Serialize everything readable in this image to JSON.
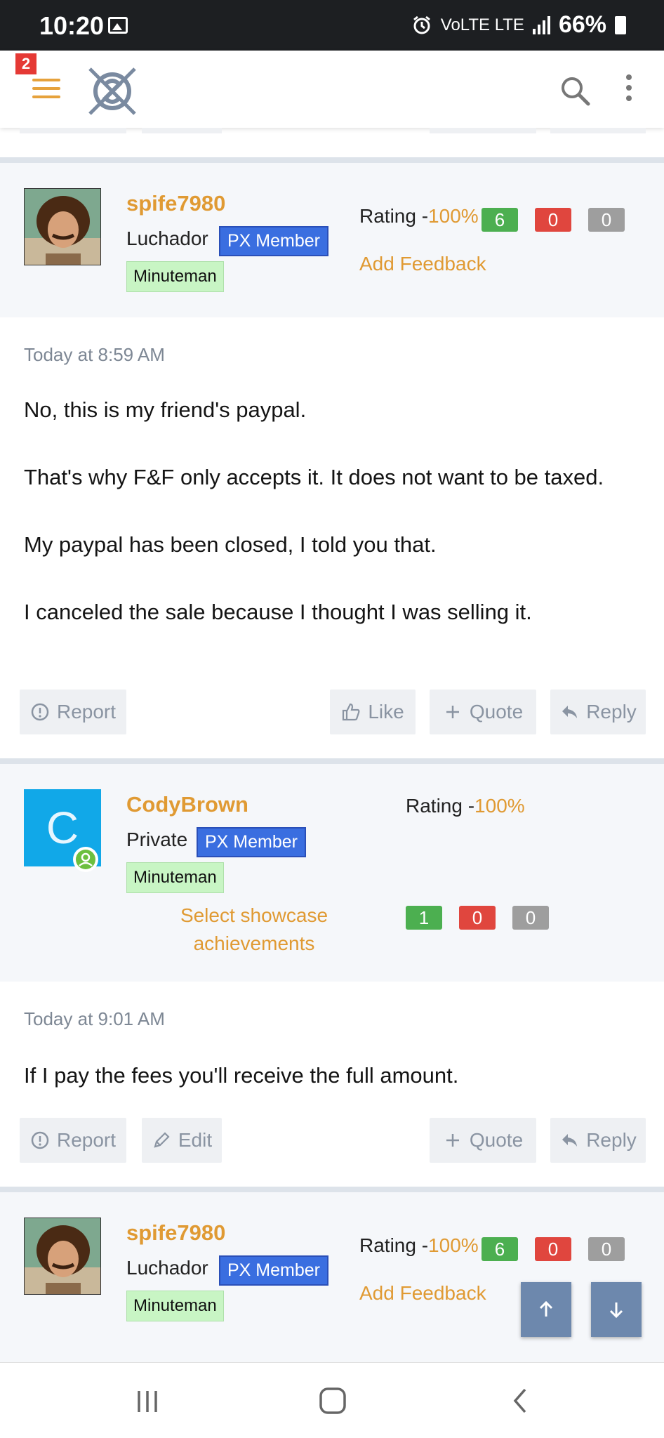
{
  "status": {
    "time": "10:20",
    "lte": "VoLTE LTE",
    "battery": "66%"
  },
  "appbar": {
    "notification_count": "2"
  },
  "posts": [
    {
      "username": "spife7980",
      "rank": "Luchador",
      "px_badge": "PX Member",
      "title_badge": "Minuteman",
      "rating_label": "Rating -",
      "rating_pct": "100%",
      "fb_pos": "6",
      "fb_neg": "0",
      "fb_neu": "0",
      "add_feedback": "Add Feedback",
      "date": "Today at 8:59 AM",
      "message": [
        "No, this is my friend's paypal.",
        "That's why F&F only accepts it. It does not want to be taxed.",
        "My paypal has been closed, I told you that.",
        "I canceled the sale because I thought I was selling it."
      ],
      "buttons": {
        "report": "Report",
        "like": "Like",
        "quote": "Quote",
        "reply": "Reply"
      }
    },
    {
      "username": "CodyBrown",
      "avatar_letter": "C",
      "rank": "Private",
      "px_badge": "PX Member",
      "title_badge": "Minuteman",
      "showcase": "Select showcase achievements",
      "rating_label": "Rating -",
      "rating_pct": "100%",
      "fb_pos": "1",
      "fb_neg": "0",
      "fb_neu": "0",
      "date": "Today at 9:01 AM",
      "message": [
        "If I pay the fees you'll receive the full amount."
      ],
      "buttons": {
        "report": "Report",
        "edit": "Edit",
        "quote": "Quote",
        "reply": "Reply"
      }
    },
    {
      "username": "spife7980",
      "rank": "Luchador",
      "px_badge": "PX Member",
      "title_badge": "Minuteman",
      "rating_label": "Rating -",
      "rating_pct": "100%",
      "fb_pos": "6",
      "fb_neg": "0",
      "fb_neu": "0",
      "add_feedback": "Add Feedback"
    }
  ],
  "colors": {
    "accent": "#e09a33",
    "badge_blue": "#3a6ee0",
    "fab": "#6d88ad"
  }
}
